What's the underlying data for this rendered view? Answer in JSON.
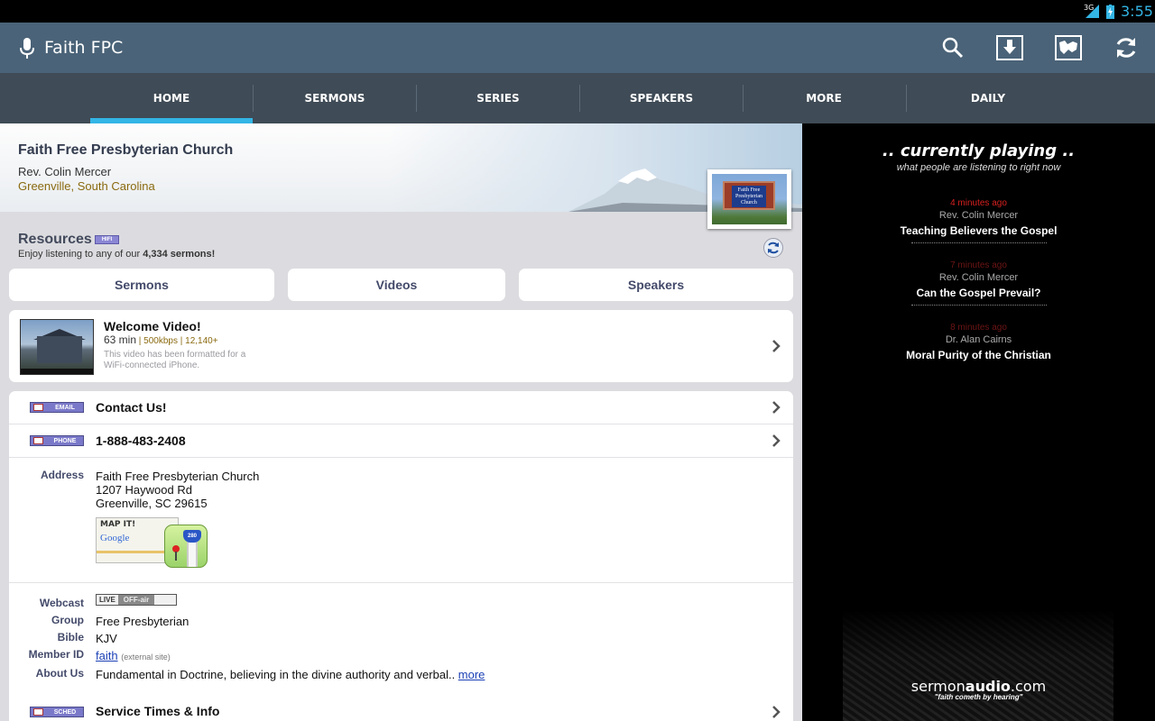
{
  "status": {
    "network": "3G",
    "time": "3:55"
  },
  "actionbar": {
    "title": "Faith FPC"
  },
  "tabs": [
    {
      "label": "HOME",
      "active": true
    },
    {
      "label": "SERMONS"
    },
    {
      "label": "SERIES"
    },
    {
      "label": "SPEAKERS"
    },
    {
      "label": "MORE"
    },
    {
      "label": "DAILY"
    }
  ],
  "church": {
    "name": "Faith Free Presbyterian Church",
    "pastor": "Rev. Colin Mercer",
    "location": "Greenville, South Carolina",
    "photo_sign": "Faith Free Presbyterian Church"
  },
  "resources": {
    "title": "Resources",
    "hifi_badge": "HIFI",
    "subtitle_prefix": "Enjoy listening to any of our ",
    "sermon_count": "4,334 sermons!",
    "buttons": [
      "Sermons",
      "Videos",
      "Speakers"
    ]
  },
  "video": {
    "title": "Welcome Video!",
    "duration": "63 min",
    "details": " | 500kbps | 12,140+",
    "note": "This video has been formatted for a WiFi-connected iPhone."
  },
  "contact": {
    "email_badge": "EMAIL",
    "email_label": "Contact Us!",
    "phone_badge": "PHONE",
    "phone_label": "1-888-483-2408"
  },
  "address": {
    "key": "Address",
    "line1": "Faith Free Presbyterian Church",
    "line2": "1207 Haywood Rd",
    "line3": "Greenville, SC 29615",
    "map_label": "MAP IT!",
    "map_brand": "Google",
    "map_route": "280"
  },
  "details": {
    "webcast_key": "Webcast",
    "webcast_live": "LIVE",
    "webcast_status": "OFF-air",
    "group_key": "Group",
    "group_val": "Free Presbyterian",
    "bible_key": "Bible",
    "bible_val": "KJV",
    "member_key": "Member ID",
    "member_val": "faith",
    "member_ext": "(external site)",
    "about_key": "About Us",
    "about_val": "Fundamental in Doctrine, believing in the divine authority and verbal.. ",
    "about_more": "more"
  },
  "schedule": {
    "badge": "SCHED",
    "label": "Service Times & Info"
  },
  "now_playing": {
    "title": ".. currently playing ..",
    "subtitle": "what people are listening to right now",
    "items": [
      {
        "time": "4 minutes ago",
        "speaker": "Rev. Colin Mercer",
        "sermon": "Teaching Believers the Gospel"
      },
      {
        "time": "7 minutes ago",
        "speaker": "Rev. Colin Mercer",
        "sermon": "Can the Gospel Prevail?"
      },
      {
        "time": "8 minutes ago",
        "speaker": "Dr. Alan Cairns",
        "sermon": "Moral Purity of the Christian"
      }
    ]
  },
  "brand": {
    "name_pre": "sermon",
    "name_bold": "audio",
    "name_post": ".com",
    "tagline": "\"faith cometh by hearing\""
  },
  "colors": {
    "actionbar": "#4a6378",
    "tabbar": "#3f4b56",
    "accent": "#33b5e5"
  }
}
